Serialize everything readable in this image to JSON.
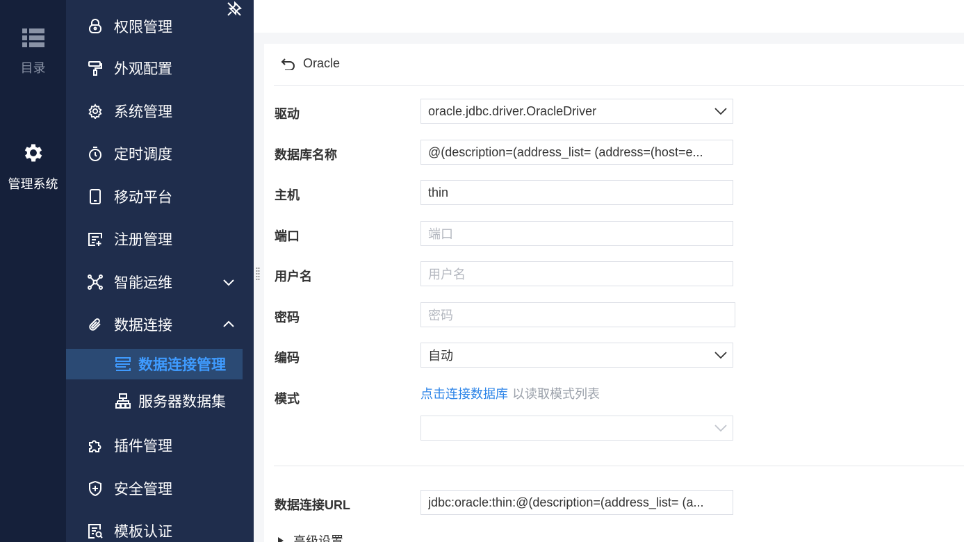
{
  "rail": {
    "catalog_label": "目录",
    "admin_label": "管理系统"
  },
  "menu": {
    "items": [
      {
        "label": "权限管理",
        "icon": "lock-icon"
      },
      {
        "label": "外观配置",
        "icon": "paint-roller-icon"
      },
      {
        "label": "系统管理",
        "icon": "gear-icon"
      },
      {
        "label": "定时调度",
        "icon": "stopwatch-icon"
      },
      {
        "label": "移动平台",
        "icon": "tablet-icon"
      },
      {
        "label": "注册管理",
        "icon": "register-icon"
      },
      {
        "label": "智能运维",
        "icon": "network-icon",
        "expanded": false
      },
      {
        "label": "数据连接",
        "icon": "paperclip-icon",
        "expanded": true
      },
      {
        "label": "数据连接管理",
        "icon": "database-icon",
        "active": true
      },
      {
        "label": "服务器数据集",
        "icon": "server-dataset-icon"
      },
      {
        "label": "插件管理",
        "icon": "puzzle-icon"
      },
      {
        "label": "安全管理",
        "icon": "shield-icon"
      },
      {
        "label": "模板认证",
        "icon": "template-cert-icon"
      }
    ]
  },
  "form": {
    "back_label": "Oracle",
    "driver": {
      "label": "驱动",
      "value": "oracle.jdbc.driver.OracleDriver"
    },
    "dbname": {
      "label": "数据库名称",
      "value": "@(description=(address_list= (address=(host=e..."
    },
    "host": {
      "label": "主机",
      "value": "thin"
    },
    "port": {
      "label": "端口",
      "placeholder": "端口"
    },
    "username": {
      "label": "用户名",
      "placeholder": "用户名"
    },
    "password": {
      "label": "密码",
      "placeholder": "密码"
    },
    "encoding": {
      "label": "编码",
      "value": "自动"
    },
    "schema": {
      "label": "模式",
      "link": "点击连接数据库",
      "hint": "以读取模式列表",
      "value": ""
    },
    "url": {
      "label": "数据连接URL",
      "value": "jdbc:oracle:thin:@(description=(address_list= (a..."
    },
    "advanced_label": "高级设置"
  },
  "colors": {
    "accent": "#3f9bff",
    "sidebar": "#1f2d4c",
    "rail": "#15203a",
    "link": "#2f86e8"
  }
}
